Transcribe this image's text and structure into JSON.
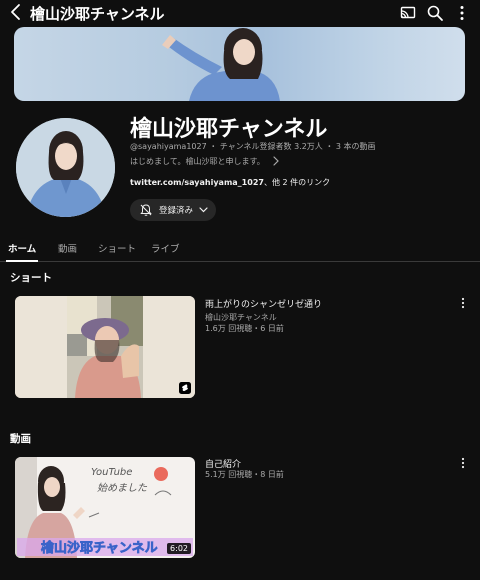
{
  "header": {
    "title": "檜山沙耶チャンネル"
  },
  "channel": {
    "name": "檜山沙耶チャンネル",
    "meta": "@sayahiyama1027 ・ チャンネル登録者数 3.2万人 ・ 3 本の動画",
    "description": "はじめまして。檜山沙耶と申します。",
    "link": "twitter.com/sayahiyama_1027",
    "link_rest": "、他 2 件のリンク",
    "subscribe_label": "登録済み"
  },
  "tabs": [
    {
      "label": "ホーム",
      "active": true
    },
    {
      "label": "動画",
      "active": false
    },
    {
      "label": "ショート",
      "active": false
    },
    {
      "label": "ライブ",
      "active": false
    }
  ],
  "sections": {
    "shorts_title": "ショート",
    "videos_title": "動画"
  },
  "shorts": [
    {
      "title": "雨上がりのシャンゼリゼ通り",
      "channel": "檜山沙耶チャンネル",
      "stats": "1.6万 回視聴・6 日前"
    }
  ],
  "videos": [
    {
      "title": "自己紹介",
      "stats": "5.1万 回視聴・8 日前",
      "duration": "6:02",
      "overlay_text": "檜山沙耶チャンネル",
      "board_text_1": "YouTube",
      "board_text_2": "始めました"
    }
  ],
  "icons": {
    "back": "chevron-left-icon",
    "cast": "cast-icon",
    "search": "search-icon",
    "more": "more-vert-icon",
    "bell": "bell-off-icon",
    "shorts": "shorts-icon"
  }
}
